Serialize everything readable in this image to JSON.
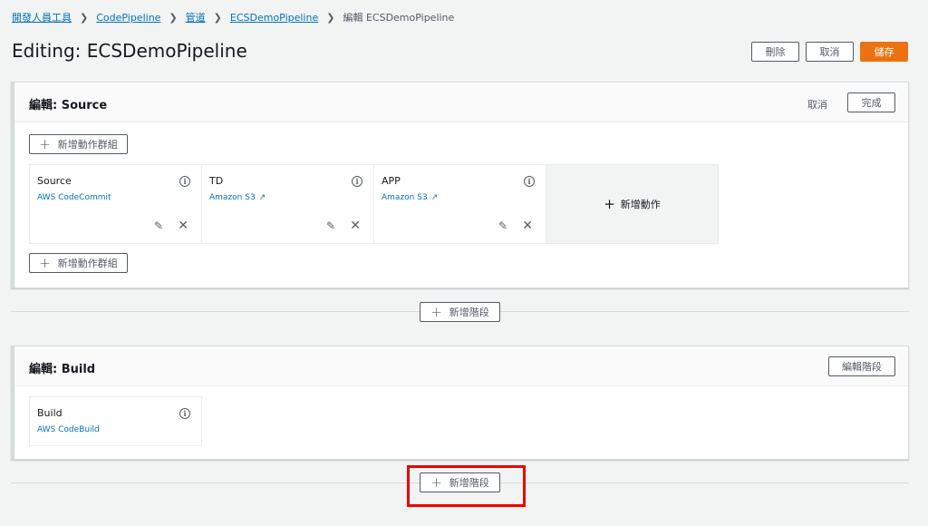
{
  "breadcrumb": {
    "items": [
      "開發人員工具",
      "CodePipeline",
      "管道",
      "ECSDemoPipeline"
    ],
    "current": "編輯 ECSDemoPipeline"
  },
  "page": {
    "title": "Editing: ECSDemoPipeline",
    "delete_label": "刪除",
    "cancel_label": "取消",
    "save_label": "儲存"
  },
  "source_stage": {
    "title": "編輯: Source",
    "cancel_label": "取消",
    "done_label": "完成",
    "add_group_label": "新增動作群組",
    "add_action_label": "新增動作",
    "actions": [
      {
        "name": "Source",
        "provider": "AWS CodeCommit"
      },
      {
        "name": "TD",
        "provider": "Amazon S3"
      },
      {
        "name": "APP",
        "provider": "Amazon S3"
      }
    ]
  },
  "add_stage_label": "新增階段",
  "build_stage": {
    "title": "編輯: Build",
    "edit_stage_label": "編輯階段",
    "actions": [
      {
        "name": "Build",
        "provider": "AWS CodeBuild"
      }
    ]
  },
  "colors": {
    "link": "#0073bb",
    "primary": "#ec7211",
    "highlight": "#e00000"
  }
}
